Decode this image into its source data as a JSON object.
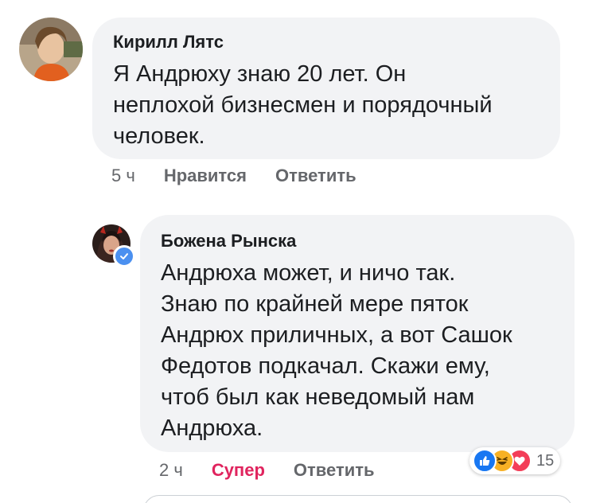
{
  "comments": [
    {
      "author": "Кирилл Лятс",
      "text": "Я Андрюху знаю 20 лет. Он\nнеплохой бизнесмен и порядочный\nчеловек.",
      "time": "5 ч",
      "like_label": "Нравится",
      "reply_label": "Ответить",
      "avatar": "user-photo"
    },
    {
      "author": "Божена Рынска",
      "text": "Андрюха может, и ничо так.\nЗнаю по крайней мере пяток\nАндрюх приличных, а вот Сашок\nФедотов подкачал. Скажи ему,\nчтоб был как неведомый нам\nАндрюха.",
      "time": "2 ч",
      "reaction_label": "Супер",
      "reply_label": "Ответить",
      "verified": true,
      "avatar": "user-photo",
      "reactions": {
        "icons": [
          "like-icon",
          "haha-icon",
          "love-icon"
        ],
        "count": "15"
      }
    }
  ],
  "colors": {
    "bubble": "#f2f3f5",
    "muted": "#65676b",
    "super": "#e0245e",
    "like": "#1877f2",
    "haha": "#f7b125",
    "love": "#f33e58",
    "verified": "#4b90f0"
  }
}
